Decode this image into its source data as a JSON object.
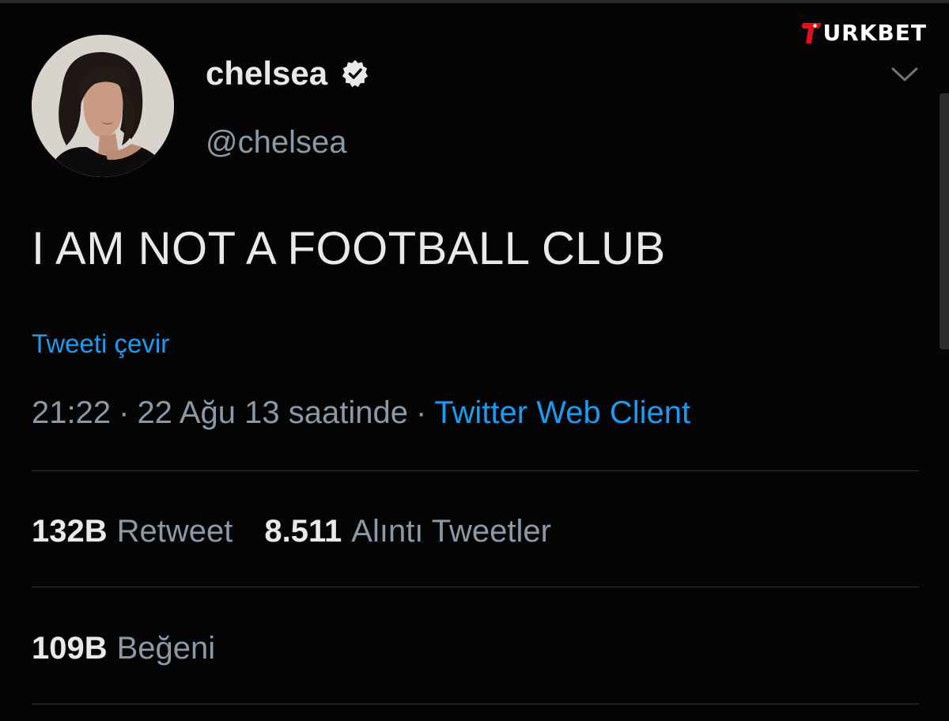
{
  "watermark": {
    "text": "URKBET",
    "colors": {
      "accent": "#e3101b",
      "text": "#ffffff"
    }
  },
  "tweet": {
    "author": {
      "display_name": "chelsea",
      "handle": "@chelsea",
      "verified": true
    },
    "text": "I AM NOT A FOOTBALL CLUB",
    "translate_link": "Tweeti çevir",
    "meta": {
      "time": "21:22",
      "separator": "·",
      "date": "22 Ağu 13 saatinde",
      "client": "Twitter Web Client"
    },
    "stats": {
      "retweets_count": "132B",
      "retweets_label": "Retweet",
      "quotes_count": "8.511",
      "quotes_label": "Alıntı Tweetler",
      "likes_count": "109B",
      "likes_label": "Beğeni"
    }
  },
  "icons": {
    "verified": "verified-badge-icon",
    "more": "chevron-down-icon"
  },
  "colors": {
    "background": "#050505",
    "text": "#e7e9ea",
    "muted": "#8b98a5",
    "link": "#1d9bf0",
    "divider": "#2f3336"
  }
}
